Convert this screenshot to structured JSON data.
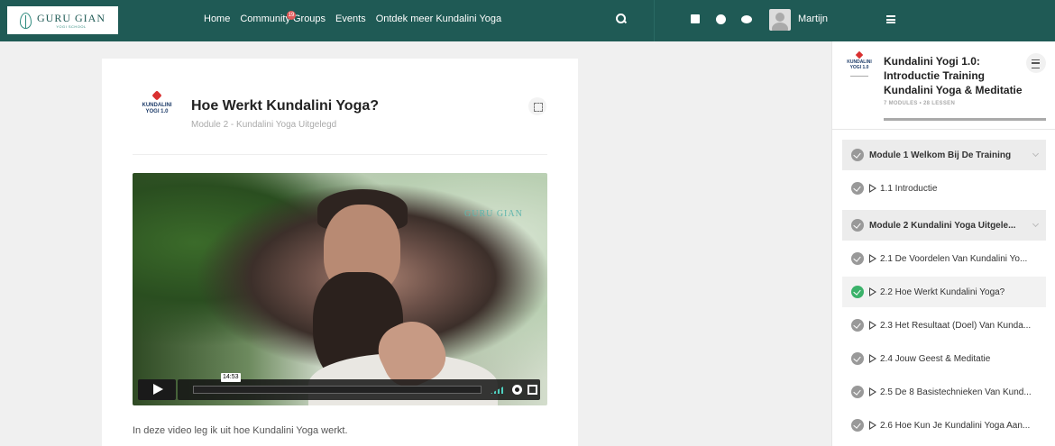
{
  "header": {
    "logo": {
      "title": "GURU GIAN",
      "subtitle": "YOGI SCHOOL"
    },
    "nav": [
      {
        "label": "Home"
      },
      {
        "label": "Community"
      },
      {
        "label": "Groups"
      },
      {
        "label": "Events"
      },
      {
        "label": "Ontdek meer Kundalini Yoga"
      }
    ],
    "community_badge": "19",
    "user_name": "Martijn",
    "icons": [
      "search-icon",
      "calendar-icon",
      "globe-icon",
      "chat-icon",
      "menu-icon"
    ]
  },
  "lesson": {
    "course_logo": {
      "line1": "KUNDALINI",
      "line2": "YOGI 1.0"
    },
    "title": "Hoe Werkt Kundalini Yoga?",
    "subtitle": "Module 2 - Kundalini Yoga Uitgelegd",
    "video": {
      "watermark": "GURU GIAN",
      "time_tooltip": "14:53"
    },
    "description": "In deze video leg ik uit hoe Kundalini Yoga werkt."
  },
  "sidebar": {
    "course_logo": {
      "line1": "KUNDALINI",
      "line2": "YOGI 1.0"
    },
    "course_title": "Kundalini Yogi 1.0: Introductie Training Kundalini Yoga & Meditatie",
    "course_meta": "7 MODULES  •  28 LESSEN",
    "items": [
      {
        "type": "module",
        "label": "Module 1   Welkom Bij De Training",
        "done": false
      },
      {
        "type": "lesson",
        "label": "1.1 Introductie",
        "done": false
      },
      {
        "type": "module",
        "label": "Module 2   Kundalini Yoga Uitgele...",
        "done": false
      },
      {
        "type": "lesson",
        "label": "2.1 De Voordelen Van Kundalini Yo...",
        "done": false
      },
      {
        "type": "lesson",
        "label": "2.2 Hoe Werkt Kundalini Yoga?",
        "done": true,
        "active": true
      },
      {
        "type": "lesson",
        "label": "2.3 Het Resultaat (Doel) Van Kunda...",
        "done": false
      },
      {
        "type": "lesson",
        "label": "2.4 Jouw Geest & Meditatie",
        "done": false
      },
      {
        "type": "lesson",
        "label": "2.5 De 8 Basistechnieken Van Kund...",
        "done": false
      },
      {
        "type": "lesson",
        "label": "2.6 Hoe Kun Je Kundalini Yoga Aan...",
        "done": false
      }
    ]
  },
  "colors": {
    "header_bg": "#1f5a55",
    "accent_green": "#3bb26a",
    "badge_red": "#e05a5a"
  }
}
